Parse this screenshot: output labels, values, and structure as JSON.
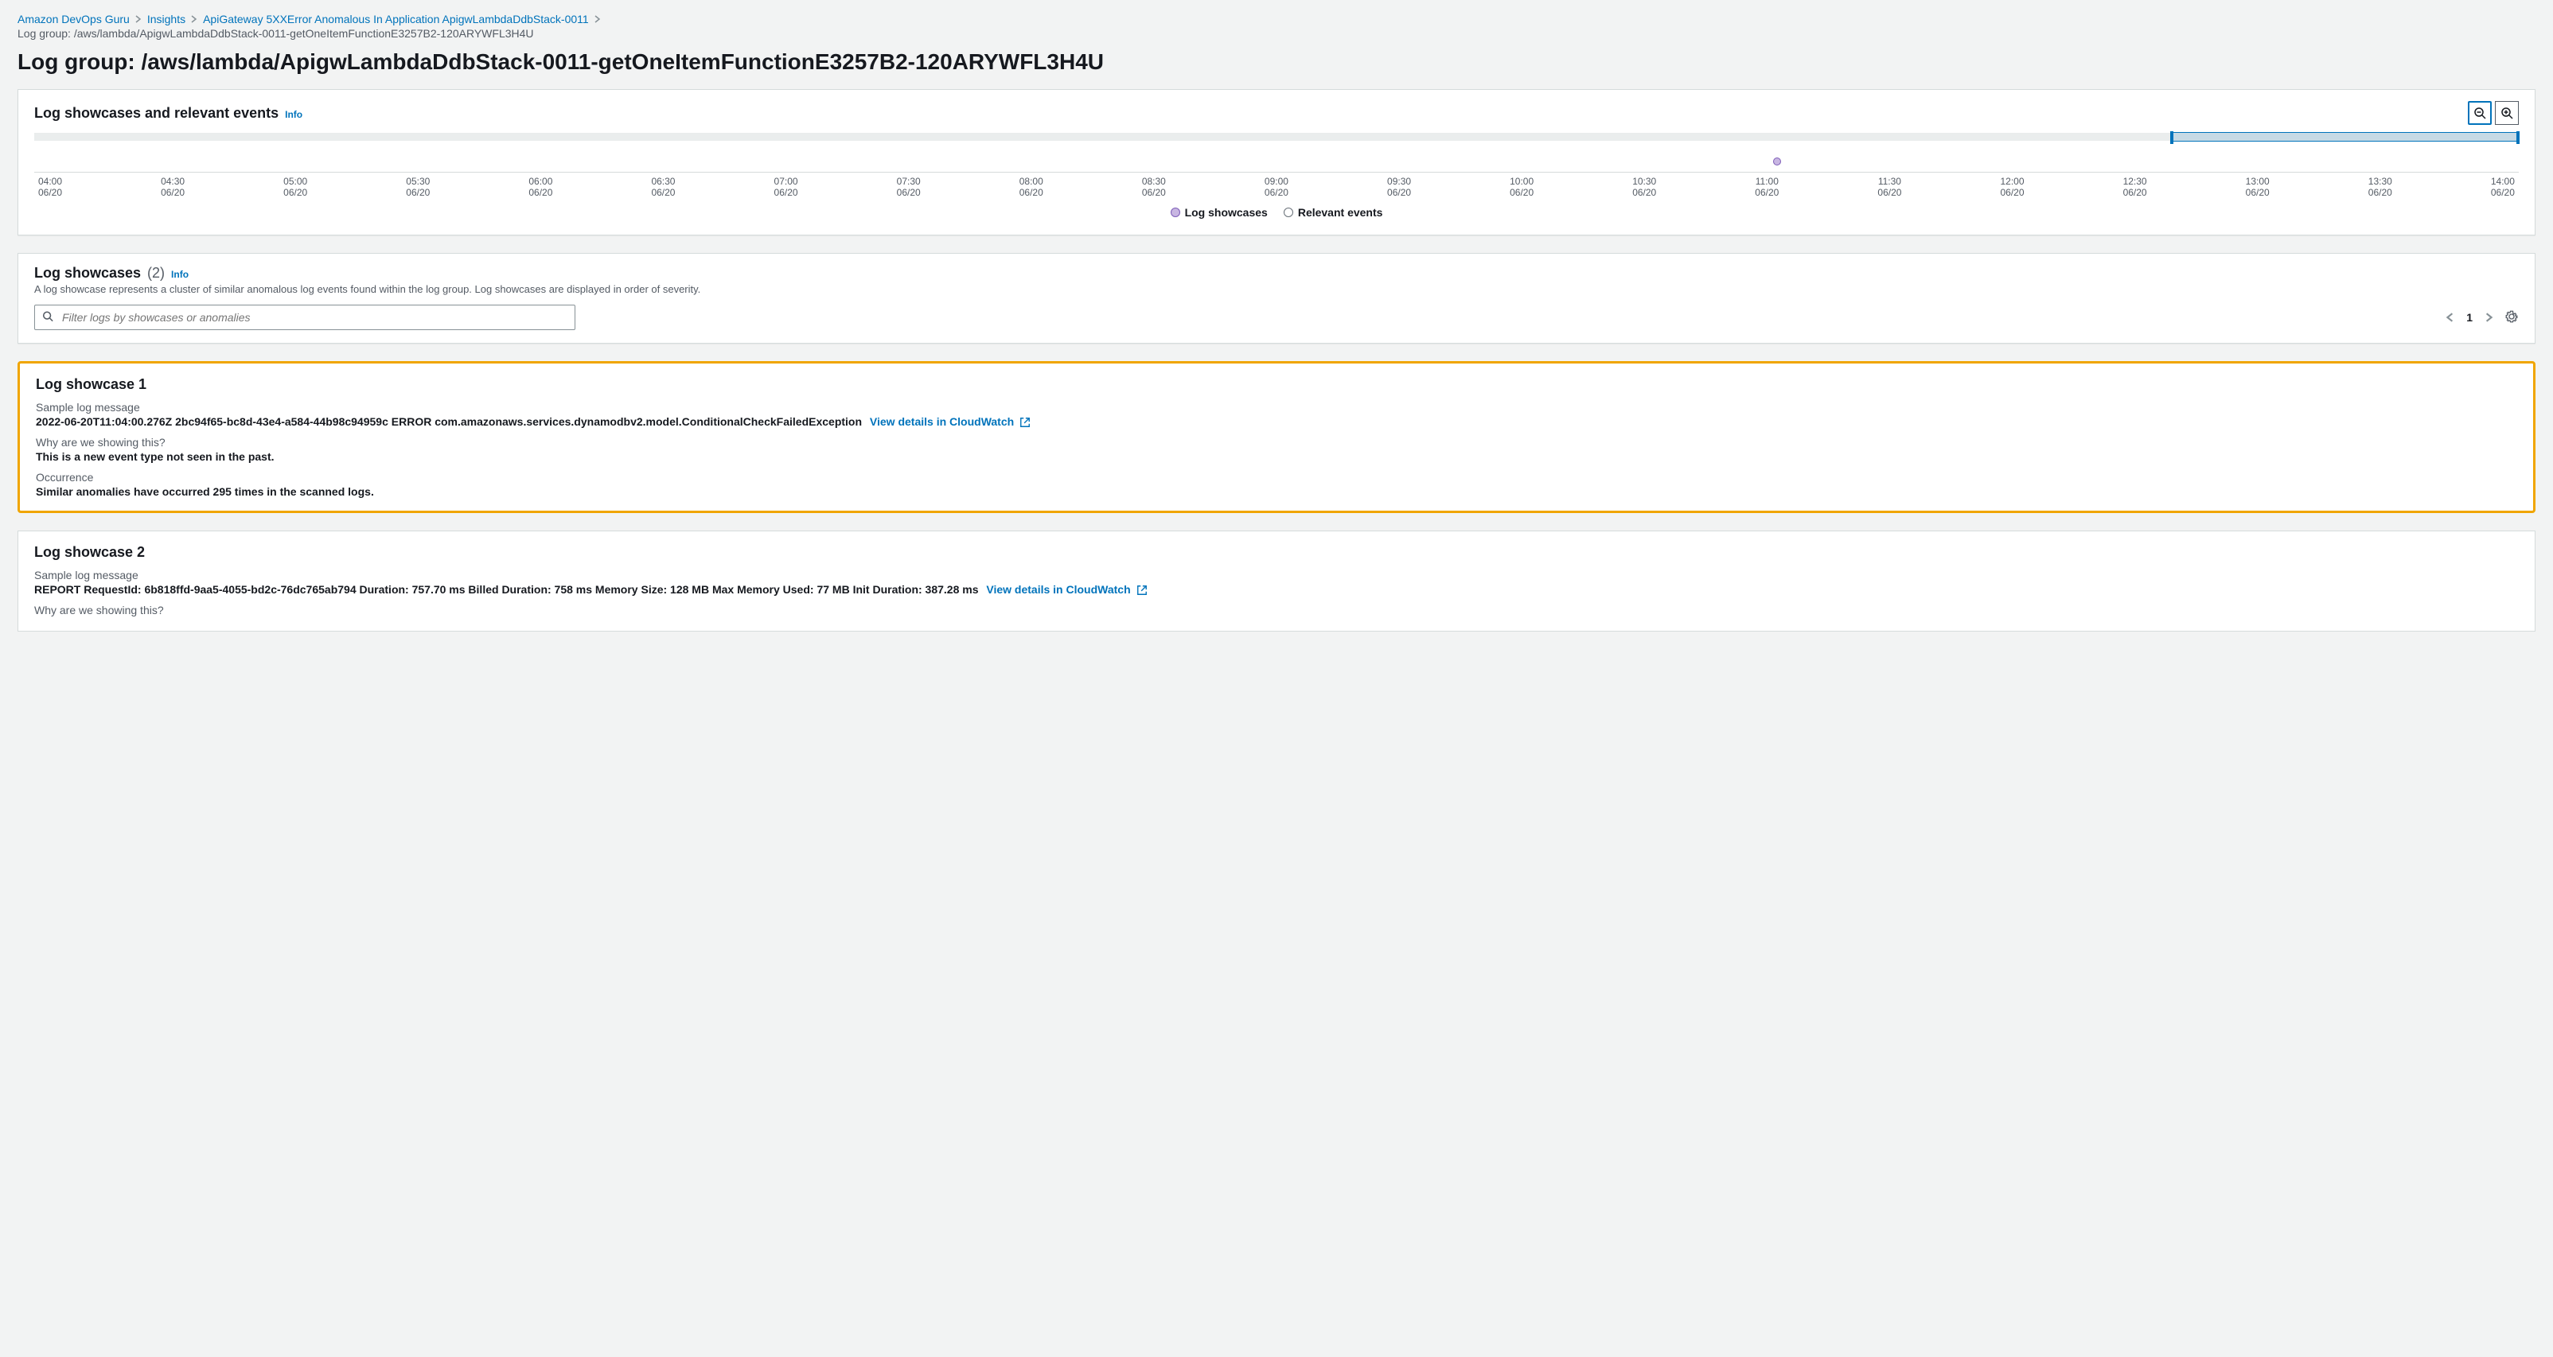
{
  "breadcrumb": {
    "items": [
      {
        "label": "Amazon DevOps Guru"
      },
      {
        "label": "Insights"
      },
      {
        "label": "ApiGateway 5XXError Anomalous In Application ApigwLambdaDdbStack-0011"
      }
    ],
    "current": "Log group: /aws/lambda/ApigwLambdaDdbStack-0011-getOneItemFunctionE3257B2-120ARYWFL3H4U"
  },
  "page_title": "Log group: /aws/lambda/ApigwLambdaDdbStack-0011-getOneItemFunctionE3257B2-120ARYWFL3H4U",
  "info_label": "Info",
  "timeline_panel": {
    "title": "Log showcases and relevant events",
    "legend": {
      "showcases": "Log showcases",
      "events": "Relevant events"
    },
    "ticks": [
      {
        "time": "04:00",
        "date": "06/20"
      },
      {
        "time": "04:30",
        "date": "06/20"
      },
      {
        "time": "05:00",
        "date": "06/20"
      },
      {
        "time": "05:30",
        "date": "06/20"
      },
      {
        "time": "06:00",
        "date": "06/20"
      },
      {
        "time": "06:30",
        "date": "06/20"
      },
      {
        "time": "07:00",
        "date": "06/20"
      },
      {
        "time": "07:30",
        "date": "06/20"
      },
      {
        "time": "08:00",
        "date": "06/20"
      },
      {
        "time": "08:30",
        "date": "06/20"
      },
      {
        "time": "09:00",
        "date": "06/20"
      },
      {
        "time": "09:30",
        "date": "06/20"
      },
      {
        "time": "10:00",
        "date": "06/20"
      },
      {
        "time": "10:30",
        "date": "06/20"
      },
      {
        "time": "11:00",
        "date": "06/20"
      },
      {
        "time": "11:30",
        "date": "06/20"
      },
      {
        "time": "12:00",
        "date": "06/20"
      },
      {
        "time": "12:30",
        "date": "06/20"
      },
      {
        "time": "13:00",
        "date": "06/20"
      },
      {
        "time": "13:30",
        "date": "06/20"
      },
      {
        "time": "14:00",
        "date": "06/20"
      }
    ],
    "dot_position_pct": 70
  },
  "showcases_panel": {
    "title": "Log showcases",
    "count": "(2)",
    "description": "A log showcase represents a cluster of similar anomalous log events found within the log group. Log showcases are displayed in order of severity.",
    "filter_placeholder": "Filter logs by showcases or anomalies",
    "page": "1"
  },
  "showcase1": {
    "title": "Log showcase 1",
    "sample_label": "Sample log message",
    "sample_value": "2022-06-20T11:04:00.276Z 2bc94f65-bc8d-43e4-a584-44b98c94959c ERROR com.amazonaws.services.dynamodbv2.model.ConditionalCheckFailedException",
    "cw_link": "View details in CloudWatch",
    "why_label": "Why are we showing this?",
    "why_value": "This is a new event type not seen in the past.",
    "occ_label": "Occurrence",
    "occ_value": "Similar anomalies have occurred 295 times in the scanned logs."
  },
  "showcase2": {
    "title": "Log showcase 2",
    "sample_label": "Sample log message",
    "sample_value": "REPORT RequestId: 6b818ffd-9aa5-4055-bd2c-76dc765ab794 Duration: 757.70 ms Billed Duration: 758 ms Memory Size: 128 MB Max Memory Used: 77 MB Init Duration: 387.28 ms",
    "cw_link": "View details in CloudWatch",
    "why_label": "Why are we showing this?"
  },
  "chart_data": {
    "type": "scatter",
    "title": "Log showcases and relevant events",
    "xlabel": "",
    "ylabel": "",
    "x_range": [
      "2022-06-20T04:00",
      "2022-06-20T14:00"
    ],
    "series": [
      {
        "name": "Log showcases",
        "points": [
          {
            "x": "2022-06-20T11:00"
          }
        ]
      },
      {
        "name": "Relevant events",
        "points": []
      }
    ],
    "ticks": [
      "04:00",
      "04:30",
      "05:00",
      "05:30",
      "06:00",
      "06:30",
      "07:00",
      "07:30",
      "08:00",
      "08:30",
      "09:00",
      "09:30",
      "10:00",
      "10:30",
      "11:00",
      "11:30",
      "12:00",
      "12:30",
      "13:00",
      "13:30",
      "14:00"
    ]
  }
}
